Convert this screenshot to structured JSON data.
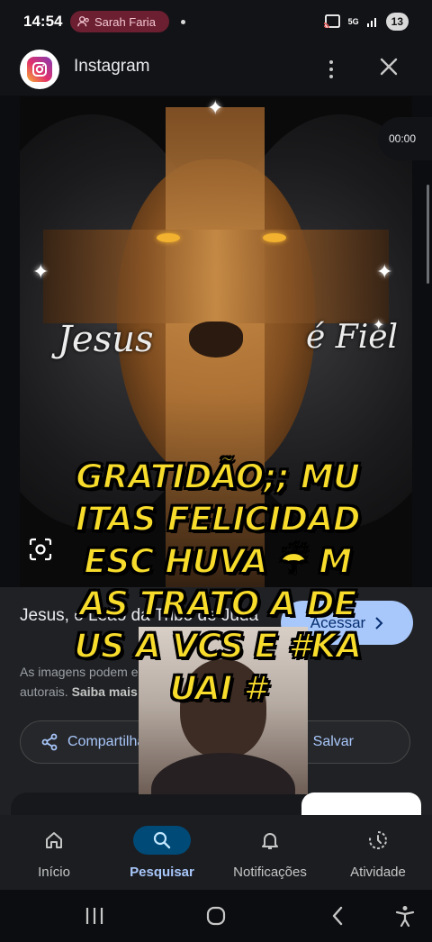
{
  "status_bar": {
    "time": "14:54",
    "profile_name": "Sarah Faria",
    "network": "5G",
    "battery": "13"
  },
  "header": {
    "app_title": "Instagram",
    "icons": {
      "logo": "instagram-logo",
      "menu": "kebab-menu-icon",
      "close": "close-icon"
    }
  },
  "hero": {
    "word_left": "Jesus",
    "word_right": "é Fiel",
    "video_time": "00:00",
    "lens_icon": "lens-search-icon"
  },
  "result": {
    "title": "Jesus, o Leão da Tribo de Judá",
    "visit_label": "Acessar",
    "disclaimer_text": "As imagens podem estar protegidas por direitos autorais.",
    "disclaimer_link": "Saiba mais",
    "share_label": "Compartilhar",
    "save_label": "Salvar"
  },
  "caption": {
    "text": "GRATIDÃO;; MUITAS FELICIDADESC HUVA ☔  MAS TRATO A DEUS A VCS E #KAUAI #"
  },
  "bottom_nav": {
    "items": [
      {
        "label": "Início",
        "icon": "home-icon",
        "active": false
      },
      {
        "label": "Pesquisar",
        "icon": "search-icon",
        "active": true
      },
      {
        "label": "Notificações",
        "icon": "bell-icon",
        "active": false
      },
      {
        "label": "Atividade",
        "icon": "activity-icon",
        "active": false
      }
    ]
  },
  "system_nav": {
    "icons": [
      "recents-icon",
      "home-button-icon",
      "back-icon",
      "accessibility-icon"
    ]
  },
  "colors": {
    "accent": "#a8c7fa",
    "caption_yellow": "#f8dc2c",
    "profile_pill": "#6b1f30",
    "active_nav": "#004a77"
  }
}
